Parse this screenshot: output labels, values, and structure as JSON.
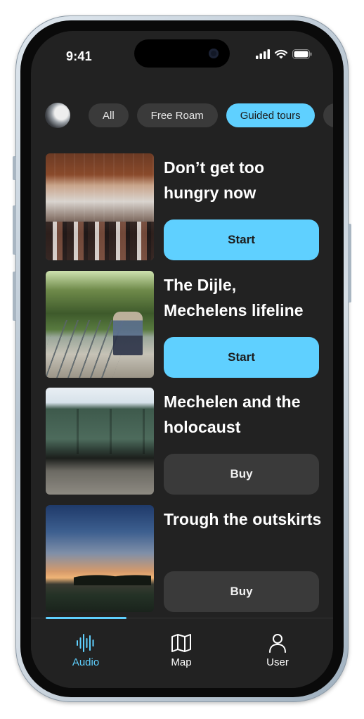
{
  "status_bar": {
    "time": "9:41",
    "icons": [
      "signal-icon",
      "wifi-icon",
      "battery-icon"
    ]
  },
  "filters": {
    "avatar": "avatar",
    "chips": [
      {
        "label": "All",
        "active": false
      },
      {
        "label": "Free Roam",
        "active": false
      },
      {
        "label": "Guided tours",
        "active": true
      }
    ]
  },
  "tours": [
    {
      "title": "Don’t get too hungry now",
      "action": "Start",
      "action_type": "start"
    },
    {
      "title": "The Dijle, Mechelens lifeline",
      "action": "Start",
      "action_type": "start"
    },
    {
      "title": "Mechelen and the holocaust",
      "action": "Buy",
      "action_type": "buy"
    },
    {
      "title": "Trough the outskirts",
      "action": "Buy",
      "action_type": "buy"
    }
  ],
  "nav": {
    "items": [
      {
        "label": "Audio",
        "icon": "audio-waves-icon",
        "active": true
      },
      {
        "label": "Map",
        "icon": "map-icon",
        "active": false
      },
      {
        "label": "User",
        "icon": "user-icon",
        "active": false
      }
    ]
  },
  "colors": {
    "accent": "#5fd0ff",
    "background": "#222222",
    "chip": "#3a3a3a"
  }
}
